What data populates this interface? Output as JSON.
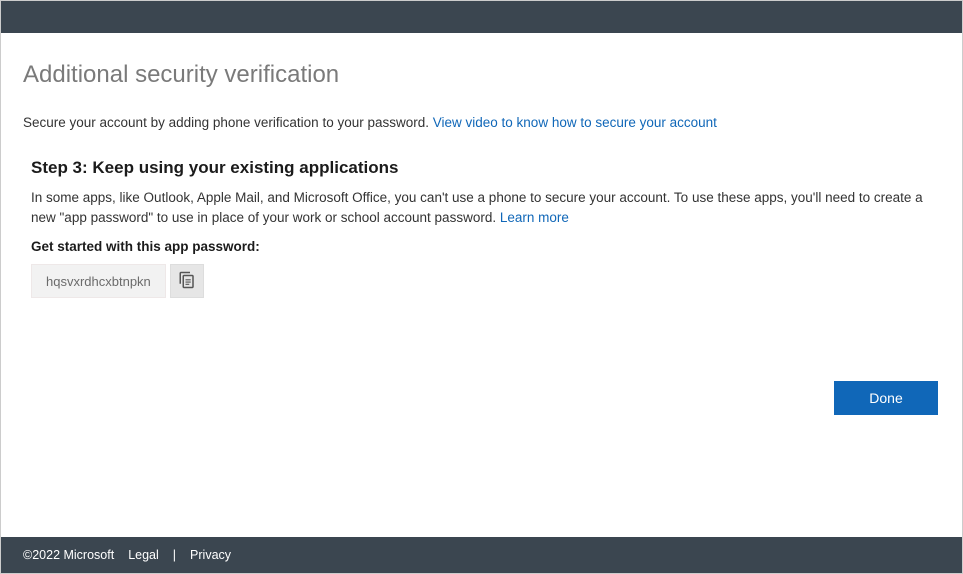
{
  "header": {
    "title": "Additional security verification",
    "subtitle_text": "Secure your account by adding phone verification to your password. ",
    "video_link_text": "View video to know how to secure your account"
  },
  "step": {
    "heading": "Step 3: Keep using your existing applications",
    "description_before": "In some apps, like Outlook, Apple Mail, and Microsoft Office, you can't use a phone to secure your account. To use these apps, you'll need to create a new \"app password\" to use in place of your work or school account password. ",
    "learn_more_text": "Learn more",
    "get_started_label": "Get started with this app password:",
    "app_password": "hqsvxrdhcxbtnpkn"
  },
  "buttons": {
    "done": "Done"
  },
  "footer": {
    "copyright": "©2022 Microsoft",
    "legal": "Legal",
    "privacy": "Privacy"
  }
}
